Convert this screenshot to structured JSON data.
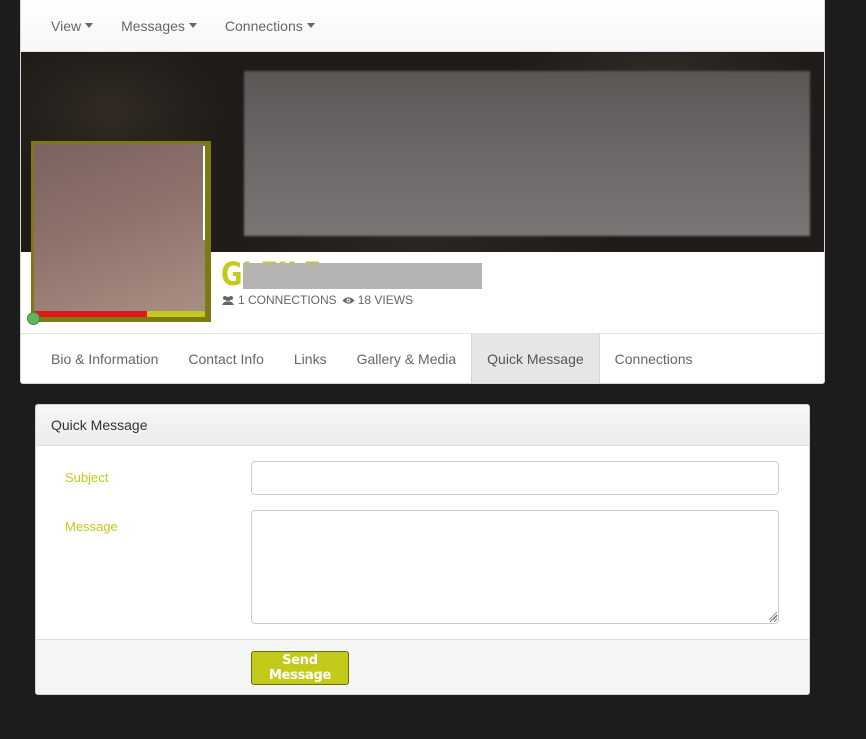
{
  "topnav": {
    "items": [
      {
        "label": "View"
      },
      {
        "label": "Messages"
      },
      {
        "label": "Connections"
      }
    ]
  },
  "profile": {
    "name": "GI        FILE",
    "connections": "1 CONNECTIONS",
    "views": "18 VIEWS",
    "completion": 0.66,
    "online": true
  },
  "tabs": [
    {
      "label": "Bio & Information"
    },
    {
      "label": "Contact Info"
    },
    {
      "label": "Links"
    },
    {
      "label": "Gallery & Media"
    },
    {
      "label": "Quick Message",
      "active": true
    },
    {
      "label": "Connections"
    }
  ],
  "panel": {
    "heading": "Quick Message",
    "subject_label": "Subject",
    "message_label": "Message",
    "subject_value": "",
    "message_value": "",
    "send_label": "Send Message"
  },
  "colors": {
    "accent": "#c2cb1c",
    "progress_fill": "#e0181b",
    "online": "#5cb85c",
    "background": "#1d1b1b"
  },
  "icons": {
    "connections": "users-icon",
    "views": "eye-icon",
    "dropdown": "caret-down-icon"
  }
}
